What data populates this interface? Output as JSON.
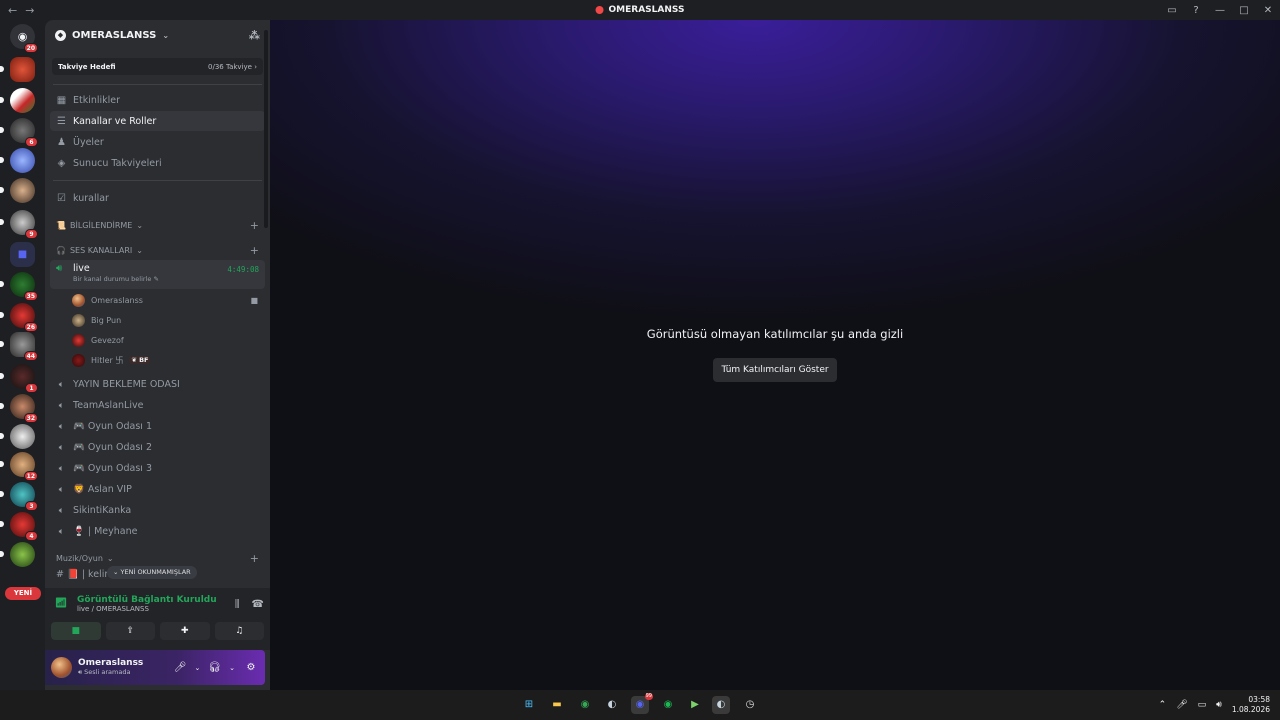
{
  "window": {
    "title": "OMERASLANSS",
    "nav_back": "←",
    "nav_fwd": "→"
  },
  "rail": {
    "servers": [
      {
        "badge": "20"
      },
      {
        "badge": ""
      },
      {
        "badge": ""
      },
      {
        "badge": "6"
      },
      {
        "badge": ""
      },
      {
        "badge": ""
      },
      {
        "badge": "9"
      },
      {
        "badge": ""
      },
      {
        "badge": "35"
      },
      {
        "badge": "26"
      },
      {
        "badge": "44"
      },
      {
        "badge": "1"
      },
      {
        "badge": "32"
      },
      {
        "badge": ""
      },
      {
        "badge": "12"
      },
      {
        "badge": "3"
      },
      {
        "badge": "4"
      },
      {
        "badge": ""
      }
    ],
    "new_label": "YENİ"
  },
  "server": {
    "name": "OMERASLANSS",
    "boost_label": "Takviye Hedefi",
    "boost_progress": "0/36 Takviye"
  },
  "nav": {
    "events": "Etkinlikler",
    "channels_roles": "Kanallar ve Roller",
    "members": "Üyeler",
    "boosts": "Sunucu Takviyeleri",
    "rules": "kurallar"
  },
  "categories": {
    "info": "BİLGİLENDİRME",
    "voice": "SES KANALLARI",
    "music": "Muzik/Oyun"
  },
  "live_channel": {
    "name": "live",
    "timer": "4:49:08",
    "status": "Bir kanal durumu belirle"
  },
  "members": [
    {
      "name": "Omeraslanss"
    },
    {
      "name": "Big Pun"
    },
    {
      "name": "Gevezof"
    },
    {
      "name": "Hitler 卐",
      "tag": "BF"
    }
  ],
  "voice_channels": [
    "YAYIN BEKLEME ODASI",
    "TeamAslanLive",
    "🎮 Oyun Odası 1",
    "🎮 Oyun Odası 2",
    "🎮 Oyun Odası 3",
    "🦁 Aslan VIP",
    "SikintiKanka",
    "🍷 | Meyhane"
  ],
  "partial_channel": "# 📕 | kelime-oyunu",
  "unread_pill": "YENİ OKUNMAMIŞLAR",
  "voice_panel": {
    "status": "Görüntülü Bağlantı Kuruldu",
    "sub": "live / OMERASLANSS"
  },
  "user": {
    "name": "Omeraslanss",
    "status": "Sesli aramada"
  },
  "main": {
    "hidden_msg": "Görüntüsü olmayan katılımcılar şu anda gizli",
    "show_all": "Tüm Katılımcıları Göster"
  },
  "taskbar": {
    "time": "03:58",
    "date": "1.08.2026",
    "discord_badge": "99"
  },
  "colors": {
    "accent_green": "#23a55a",
    "badge_red": "#da373c"
  }
}
